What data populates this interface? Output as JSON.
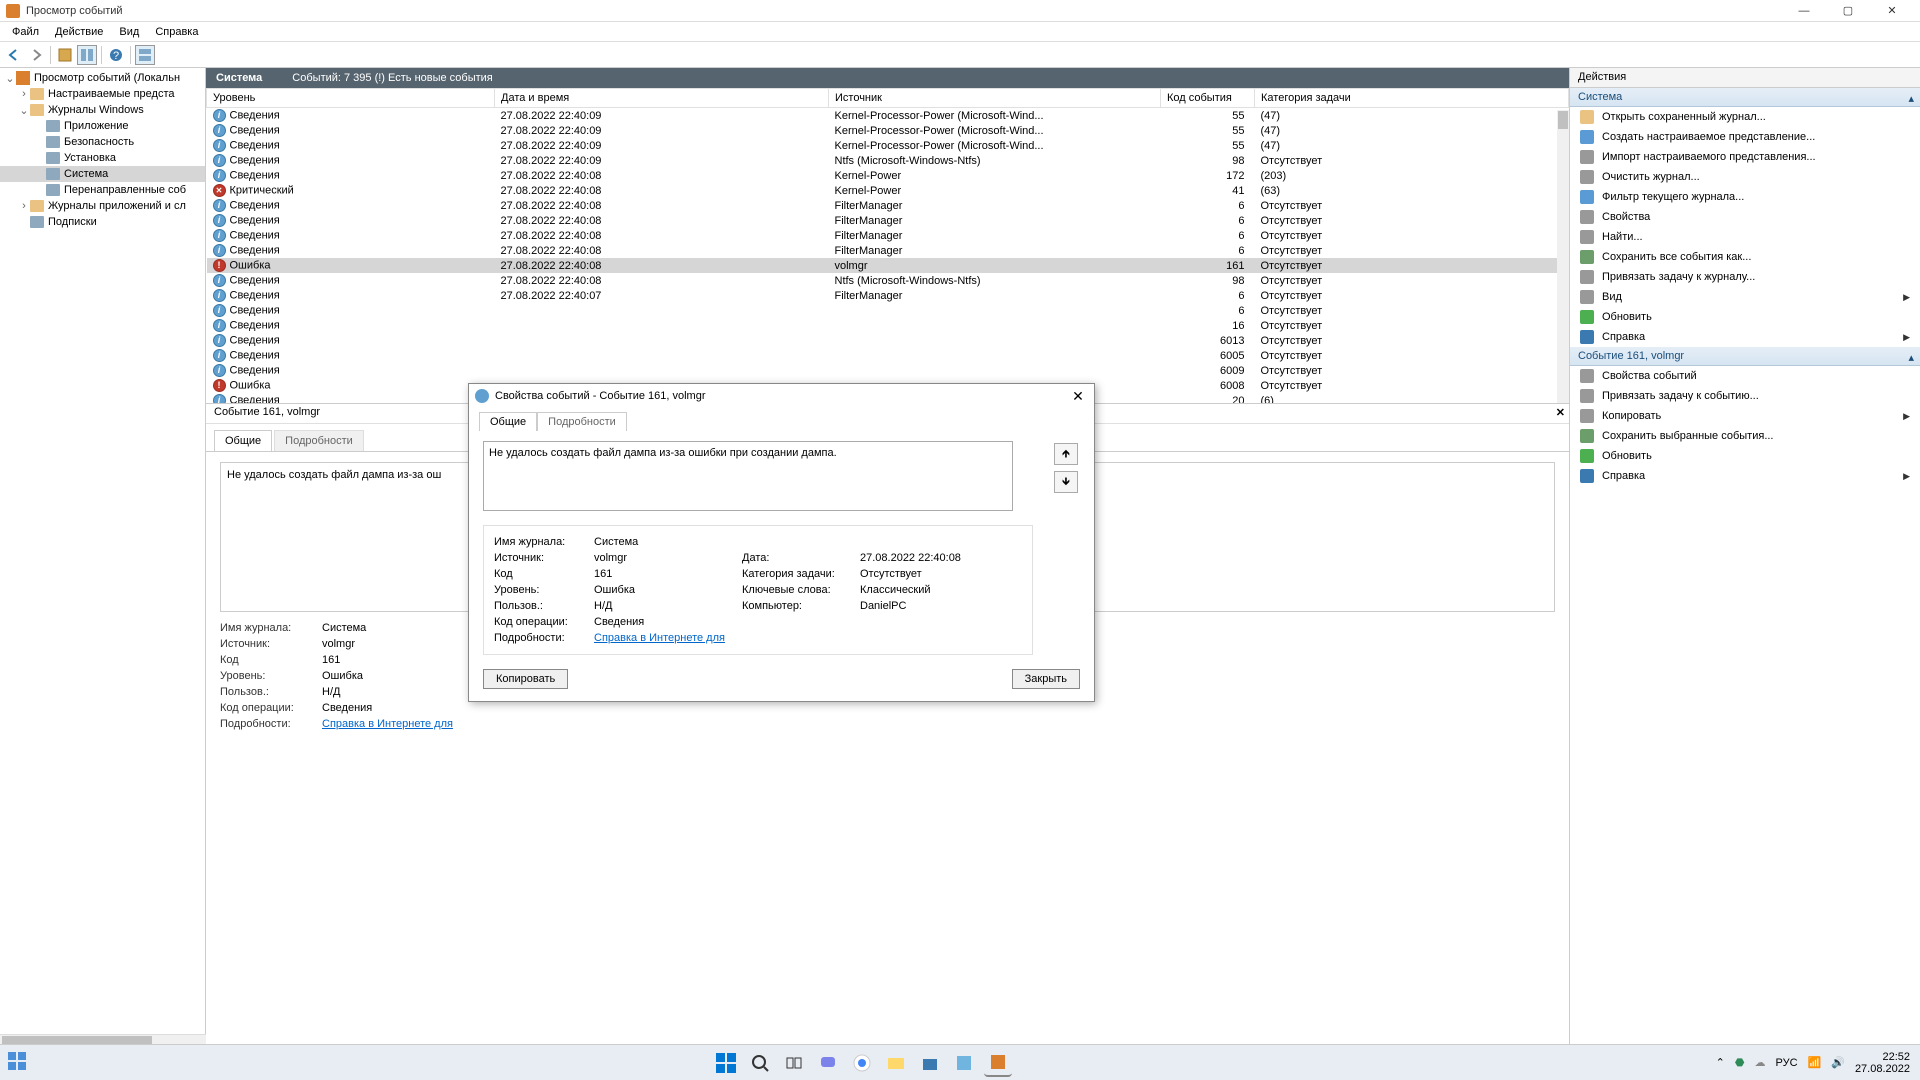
{
  "window": {
    "title": "Просмотр событий"
  },
  "menubar": [
    "Файл",
    "Действие",
    "Вид",
    "Справка"
  ],
  "tree": {
    "root": "Просмотр событий (Локальн",
    "items": [
      {
        "label": "Настраиваемые предста",
        "level": 1,
        "expander": "›",
        "icon": "folder"
      },
      {
        "label": "Журналы Windows",
        "level": 1,
        "expander": "⌄",
        "icon": "folder"
      },
      {
        "label": "Приложение",
        "level": 2,
        "icon": "log"
      },
      {
        "label": "Безопасность",
        "level": 2,
        "icon": "log"
      },
      {
        "label": "Установка",
        "level": 2,
        "icon": "log"
      },
      {
        "label": "Система",
        "level": 2,
        "icon": "log",
        "selected": true
      },
      {
        "label": "Перенаправленные соб",
        "level": 2,
        "icon": "log"
      },
      {
        "label": "Журналы приложений и сл",
        "level": 1,
        "expander": "›",
        "icon": "folder"
      },
      {
        "label": "Подписки",
        "level": 1,
        "icon": "sub"
      }
    ]
  },
  "center_header": {
    "name": "Система",
    "count": "Событий: 7 395 (!) Есть новые события"
  },
  "columns": [
    "Уровень",
    "Дата и время",
    "Источник",
    "Код события",
    "Категория задачи"
  ],
  "events": [
    {
      "lvl": "info",
      "level": "Сведения",
      "dt": "27.08.2022 22:40:09",
      "src": "Kernel-Processor-Power (Microsoft-Wind...",
      "code": "55",
      "cat": "(47)"
    },
    {
      "lvl": "info",
      "level": "Сведения",
      "dt": "27.08.2022 22:40:09",
      "src": "Kernel-Processor-Power (Microsoft-Wind...",
      "code": "55",
      "cat": "(47)"
    },
    {
      "lvl": "info",
      "level": "Сведения",
      "dt": "27.08.2022 22:40:09",
      "src": "Kernel-Processor-Power (Microsoft-Wind...",
      "code": "55",
      "cat": "(47)"
    },
    {
      "lvl": "info",
      "level": "Сведения",
      "dt": "27.08.2022 22:40:09",
      "src": "Ntfs (Microsoft-Windows-Ntfs)",
      "code": "98",
      "cat": "Отсутствует"
    },
    {
      "lvl": "info",
      "level": "Сведения",
      "dt": "27.08.2022 22:40:08",
      "src": "Kernel-Power",
      "code": "172",
      "cat": "(203)"
    },
    {
      "lvl": "critical",
      "level": "Критический",
      "dt": "27.08.2022 22:40:08",
      "src": "Kernel-Power",
      "code": "41",
      "cat": "(63)"
    },
    {
      "lvl": "info",
      "level": "Сведения",
      "dt": "27.08.2022 22:40:08",
      "src": "FilterManager",
      "code": "6",
      "cat": "Отсутствует"
    },
    {
      "lvl": "info",
      "level": "Сведения",
      "dt": "27.08.2022 22:40:08",
      "src": "FilterManager",
      "code": "6",
      "cat": "Отсутствует"
    },
    {
      "lvl": "info",
      "level": "Сведения",
      "dt": "27.08.2022 22:40:08",
      "src": "FilterManager",
      "code": "6",
      "cat": "Отсутствует"
    },
    {
      "lvl": "info",
      "level": "Сведения",
      "dt": "27.08.2022 22:40:08",
      "src": "FilterManager",
      "code": "6",
      "cat": "Отсутствует"
    },
    {
      "lvl": "error",
      "level": "Ошибка",
      "dt": "27.08.2022 22:40:08",
      "src": "volmgr",
      "code": "161",
      "cat": "Отсутствует",
      "selected": true
    },
    {
      "lvl": "info",
      "level": "Сведения",
      "dt": "27.08.2022 22:40:08",
      "src": "Ntfs (Microsoft-Windows-Ntfs)",
      "code": "98",
      "cat": "Отсутствует"
    },
    {
      "lvl": "info",
      "level": "Сведения",
      "dt": "27.08.2022 22:40:07",
      "src": "FilterManager",
      "code": "6",
      "cat": "Отсутствует"
    },
    {
      "lvl": "info",
      "level": "Сведения",
      "dt": "",
      "src": "",
      "code": "6",
      "cat": "Отсутствует"
    },
    {
      "lvl": "info",
      "level": "Сведения",
      "dt": "",
      "src": "",
      "code": "16",
      "cat": "Отсутствует"
    },
    {
      "lvl": "info",
      "level": "Сведения",
      "dt": "",
      "src": "",
      "code": "6013",
      "cat": "Отсутствует"
    },
    {
      "lvl": "info",
      "level": "Сведения",
      "dt": "",
      "src": "",
      "code": "6005",
      "cat": "Отсутствует"
    },
    {
      "lvl": "info",
      "level": "Сведения",
      "dt": "",
      "src": "",
      "code": "6009",
      "cat": "Отсутствует"
    },
    {
      "lvl": "error",
      "level": "Ошибка",
      "dt": "",
      "src": "",
      "code": "6008",
      "cat": "Отсутствует"
    },
    {
      "lvl": "info",
      "level": "Сведения",
      "dt": "",
      "src": "",
      "code": "20",
      "cat": "(6)"
    }
  ],
  "detail": {
    "title": "Событие 161, volmgr",
    "tabs": [
      "Общие",
      "Подробности"
    ],
    "message": "Не удалось создать файл дампа из-за ош",
    "fields": {
      "log_lbl": "Имя журнала:",
      "log_val": "Система",
      "src_lbl": "Источник:",
      "src_val": "volmgr",
      "date_lbl": "Дата:",
      "date_val": "27.08.2022 22:40:08",
      "code_lbl": "Код",
      "code_val": "161",
      "cat_lbl": "Категория задачи:",
      "cat_val": "Отсутствует",
      "lvl_lbl": "Уровень:",
      "lvl_val": "Ошибка",
      "kw_lbl": "Ключевые слова:",
      "kw_val": "Классический",
      "usr_lbl": "Пользов.:",
      "usr_val": "Н/Д",
      "comp_lbl": "Компьютер:",
      "comp_val": "DanielPC",
      "op_lbl": "Код операции:",
      "op_val": "Сведения",
      "more_lbl": "Подробности:",
      "more_val": "Справка в Интернете для "
    }
  },
  "modal": {
    "title": "Свойства событий - Событие 161, volmgr",
    "tabs": [
      "Общие",
      "Подробности"
    ],
    "message": "Не удалось создать файл дампа из-за ошибки при создании дампа.",
    "copy": "Копировать",
    "close": "Закрыть"
  },
  "actions": {
    "title": "Действия",
    "section1": "Система",
    "items1": [
      {
        "label": "Открыть сохраненный журнал...",
        "icon": "open"
      },
      {
        "label": "Создать настраиваемое представление...",
        "icon": "filter"
      },
      {
        "label": "Импорт настраиваемого представления...",
        "icon": "import"
      },
      {
        "label": "Очистить журнал...",
        "icon": "clear"
      },
      {
        "label": "Фильтр текущего журнала...",
        "icon": "filter"
      },
      {
        "label": "Свойства",
        "icon": "props"
      },
      {
        "label": "Найти...",
        "icon": "find"
      },
      {
        "label": "Сохранить все события как...",
        "icon": "save"
      },
      {
        "label": "Привязать задачу к журналу...",
        "icon": "task"
      },
      {
        "label": "Вид",
        "icon": "view",
        "arrow": true
      },
      {
        "label": "Обновить",
        "icon": "refresh"
      },
      {
        "label": "Справка",
        "icon": "help",
        "arrow": true
      }
    ],
    "section2": "Событие 161, volmgr",
    "items2": [
      {
        "label": "Свойства событий",
        "icon": "props"
      },
      {
        "label": "Привязать задачу к событию...",
        "icon": "task"
      },
      {
        "label": "Копировать",
        "icon": "copy",
        "arrow": true
      },
      {
        "label": "Сохранить выбранные события...",
        "icon": "save"
      },
      {
        "label": "Обновить",
        "icon": "refresh"
      },
      {
        "label": "Справка",
        "icon": "help",
        "arrow": true
      }
    ]
  },
  "taskbar": {
    "lang": "РУС",
    "time": "22:52",
    "date": "27.08.2022"
  }
}
